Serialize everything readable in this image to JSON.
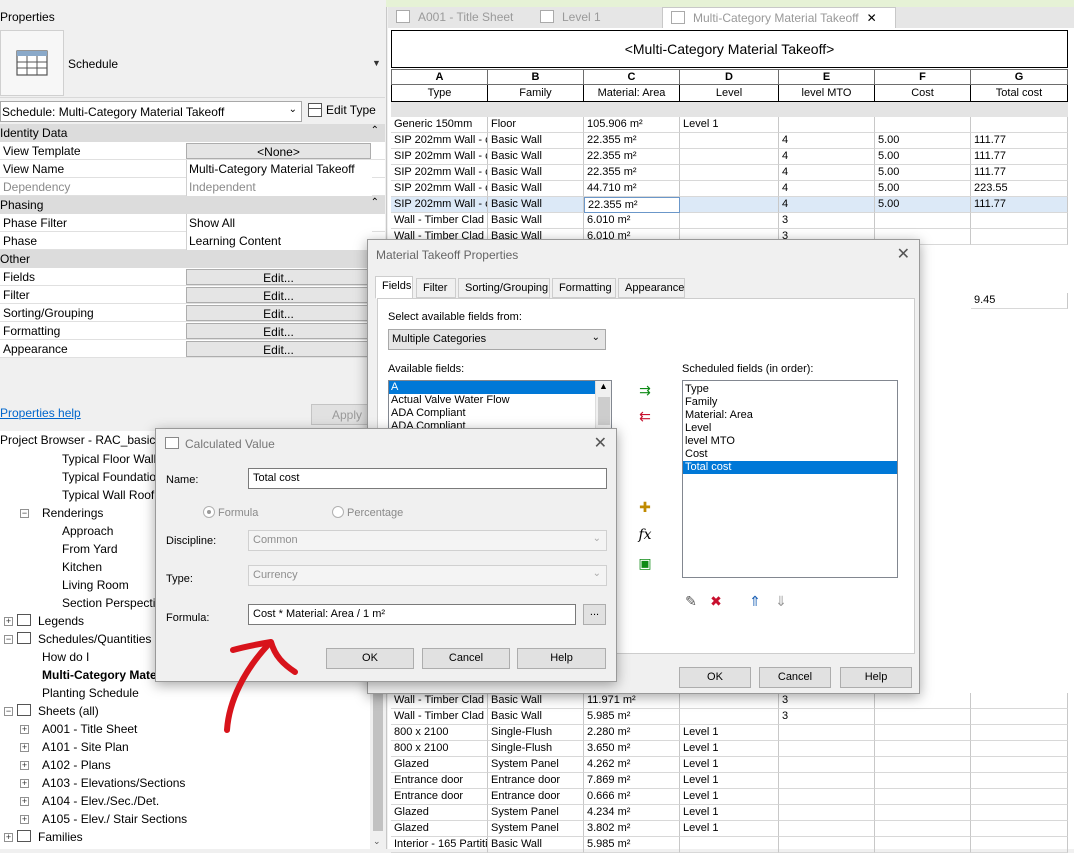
{
  "properties": {
    "title": "Properties",
    "type_name": "Schedule",
    "schedule_selector": "Schedule: Multi-Category Material Takeoff",
    "edit_type": "Edit Type",
    "sections": {
      "identity": "Identity Data",
      "phasing": "Phasing",
      "other": "Other"
    },
    "rows": {
      "view_template_key": "View Template",
      "view_template_val": "<None>",
      "view_name_key": "View Name",
      "view_name_val": "Multi-Category Material Takeoff",
      "dependency_key": "Dependency",
      "dependency_val": "Independent",
      "phase_filter_key": "Phase Filter",
      "phase_filter_val": "Show All",
      "phase_key": "Phase",
      "phase_val": "Learning Content",
      "fields_key": "Fields",
      "filter_key": "Filter",
      "sorting_key": "Sorting/Grouping",
      "formatting_key": "Formatting",
      "appearance_key": "Appearance",
      "edit_label": "Edit..."
    },
    "help_link": "Properties help",
    "apply": "Apply"
  },
  "browser": {
    "title": "Project Browser - RAC_basic_s",
    "items": [
      "Typical Floor Wall",
      "Typical Foundatio",
      "Typical Wall Roof",
      "Renderings",
      "Approach",
      "From Yard",
      "Kitchen",
      "Living Room",
      "Section Perspectiv",
      "Legends",
      "Schedules/Quantities (",
      "How do I",
      "Multi-Category Mate",
      "Planting Schedule",
      "Sheets (all)",
      "A001 - Title Sheet",
      "A101 - Site Plan",
      "A102 - Plans",
      "A103 - Elevations/Sections",
      "A104 - Elev./Sec./Det.",
      "A105 - Elev./ Stair Sections",
      "Families"
    ]
  },
  "tabs": [
    "A001 - Title Sheet",
    "Level 1",
    "Multi-Category Material Takeoff"
  ],
  "schedule": {
    "title": "<Multi-Category Material Takeoff>",
    "letters": [
      "A",
      "B",
      "C",
      "D",
      "E",
      "F",
      "G"
    ],
    "names": [
      "Type",
      "Family",
      "Material: Area",
      "Level",
      "level MTO",
      "Cost",
      "Total cost"
    ],
    "rows_top": [
      [
        "Generic 150mm",
        "Floor",
        "105.906 m²",
        "Level 1",
        "",
        "",
        ""
      ],
      [
        "SIP 202mm Wall - c",
        "Basic Wall",
        "22.355 m²",
        "",
        "4",
        "5.00",
        "111.77"
      ],
      [
        "SIP 202mm Wall - c",
        "Basic Wall",
        "22.355 m²",
        "",
        "4",
        "5.00",
        "111.77"
      ],
      [
        "SIP 202mm Wall - c",
        "Basic Wall",
        "22.355 m²",
        "",
        "4",
        "5.00",
        "111.77"
      ],
      [
        "SIP 202mm Wall - c",
        "Basic Wall",
        "44.710 m²",
        "",
        "4",
        "5.00",
        "223.55"
      ],
      [
        "SIP 202mm Wall - c",
        "Basic Wall",
        "22.355 m²",
        "",
        "4",
        "5.00",
        "111.77"
      ],
      [
        "Wall - Timber Clad",
        "Basic Wall",
        "6.010 m²",
        "",
        "3",
        "",
        ""
      ],
      [
        "Wall - Timber Clad",
        "Basic Wall",
        "6.010 m²",
        "",
        "3",
        "",
        ""
      ]
    ],
    "partial_g": "9.45",
    "rows_bottom": [
      [
        "Wall - Timber Clad",
        "Basic Wall",
        "11.971 m²",
        "",
        "3",
        "",
        ""
      ],
      [
        "Wall - Timber Clad",
        "Basic Wall",
        "5.985 m²",
        "",
        "3",
        "",
        ""
      ],
      [
        "800 x 2100",
        "Single-Flush",
        "2.280 m²",
        "Level 1",
        "",
        "",
        ""
      ],
      [
        "800 x 2100",
        "Single-Flush",
        "3.650 m²",
        "Level 1",
        "",
        "",
        ""
      ],
      [
        "Glazed",
        "System Panel",
        "4.262 m²",
        "Level 1",
        "",
        "",
        ""
      ],
      [
        "Entrance door",
        "Entrance door",
        "7.869 m²",
        "Level 1",
        "",
        "",
        ""
      ],
      [
        "Entrance door",
        "Entrance door",
        "0.666 m²",
        "Level 1",
        "",
        "",
        ""
      ],
      [
        "Glazed",
        "System Panel",
        "4.234 m²",
        "Level 1",
        "",
        "",
        ""
      ],
      [
        "Glazed",
        "System Panel",
        "3.802 m²",
        "Level 1",
        "",
        "",
        ""
      ],
      [
        "Interior - 165 Partiti",
        "Basic Wall",
        "5.985 m²",
        "",
        "",
        "",
        ""
      ]
    ]
  },
  "mto_dialog": {
    "title": "Material Takeoff Properties",
    "tabs": [
      "Fields",
      "Filter",
      "Sorting/Grouping",
      "Formatting",
      "Appearance"
    ],
    "select_from_label": "Select available fields from:",
    "select_from_value": "Multiple Categories",
    "available_label": "Available fields:",
    "available": [
      "A",
      "Actual Valve Water Flow",
      "ADA Compliant",
      "ADA Compliant"
    ],
    "scheduled_label": "Scheduled fields (in order):",
    "scheduled": [
      "Type",
      "Family",
      "Material: Area",
      "Level",
      "level MTO",
      "Cost",
      "Total cost"
    ],
    "ok": "OK",
    "cancel": "Cancel",
    "help": "Help"
  },
  "calc_dialog": {
    "title": "Calculated Value",
    "name_label": "Name:",
    "name_value": "Total cost",
    "formula_radio": "Formula",
    "percentage_radio": "Percentage",
    "discipline_label": "Discipline:",
    "discipline_value": "Common",
    "type_label": "Type:",
    "type_value": "Currency",
    "formula_label": "Formula:",
    "formula_value": "Cost * Material: Area / 1 m²",
    "browse": "...",
    "ok": "OK",
    "cancel": "Cancel",
    "help": "Help"
  },
  "colors": {
    "selection": "#0078d7",
    "annotation": "#d8131b",
    "link": "#0066cc"
  }
}
